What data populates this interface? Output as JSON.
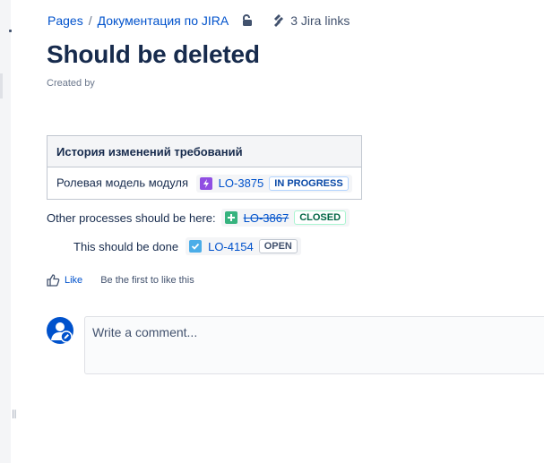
{
  "breadcrumb": {
    "pages": "Pages",
    "separator": "/",
    "space": "Документация по JIRA",
    "jira_links": "3 Jira links"
  },
  "page": {
    "title": "Should be deleted",
    "byline": "Created by"
  },
  "table": {
    "header": "История изменений требований",
    "row_label": "Ролевая модель модуля",
    "issue": {
      "key": "LO-3875",
      "status": "IN PROGRESS",
      "type_icon": "epic-icon",
      "color": "#904ee2"
    }
  },
  "lines": [
    {
      "text": "Other processes should be here:",
      "issue": {
        "key": "LO-3867",
        "status": "CLOSED",
        "type_icon": "new-feature-icon",
        "color": "#36b37e",
        "resolved": true
      }
    },
    {
      "text": "This should be done",
      "issue": {
        "key": "LO-4154",
        "status": "OPEN",
        "type_icon": "task-icon",
        "color": "#4bade8"
      }
    }
  ],
  "like": {
    "label": "Like",
    "hint": "Be the first to like this"
  },
  "comment": {
    "placeholder": "Write a comment..."
  },
  "colors": {
    "link": "#0052cc",
    "text": "#172b4d",
    "subtle": "#6b778c"
  }
}
